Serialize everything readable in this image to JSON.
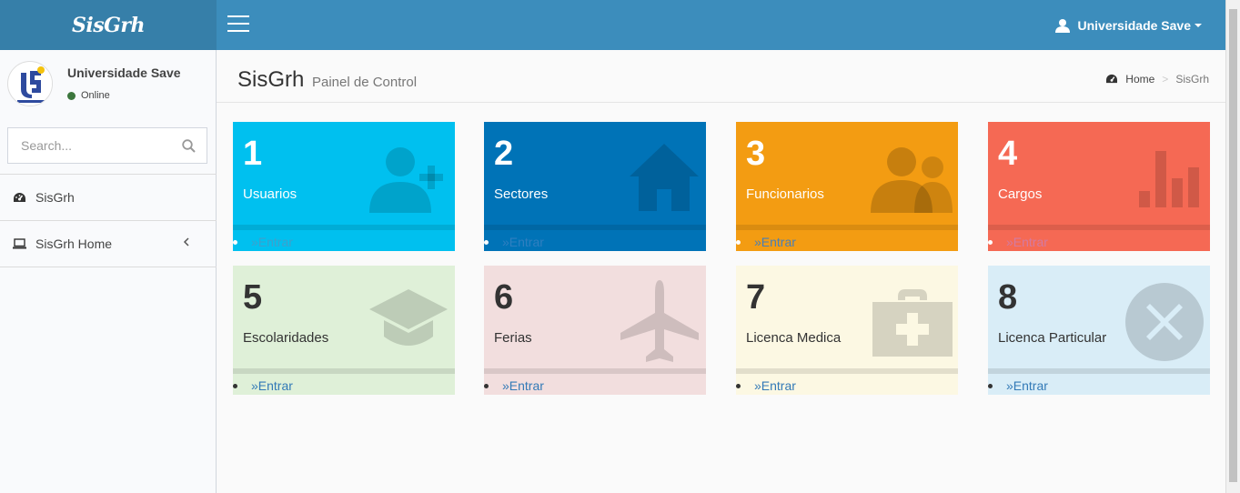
{
  "app": {
    "logo": "SisGrh"
  },
  "navbar": {
    "user": "Universidade Save"
  },
  "sidebar": {
    "user_name": "Universidade Save",
    "status": "Online",
    "search_placeholder": "Search...",
    "items": [
      {
        "label": "SisGrh"
      },
      {
        "label": "SisGrh Home"
      }
    ]
  },
  "header": {
    "title": "SisGrh",
    "subtitle": "Painel de Control",
    "breadcrumb": [
      "Home",
      "SisGrh"
    ]
  },
  "boxes": [
    {
      "number": "1",
      "label": "Usuarios",
      "link": "»Entrar",
      "icon": "add-user-icon",
      "color": "#00c0ef"
    },
    {
      "number": "2",
      "label": "Sectores",
      "link": "»Entrar",
      "icon": "home-icon",
      "color": "#0073b7"
    },
    {
      "number": "3",
      "label": "Funcionarios",
      "link": "»Entrar",
      "icon": "users-icon",
      "color": "#f39c12"
    },
    {
      "number": "4",
      "label": "Cargos",
      "link": "»Entrar",
      "icon": "bar-chart-icon",
      "color": "#f56954"
    },
    {
      "number": "5",
      "label": "Escolaridades",
      "link": "»Entrar",
      "icon": "graduation-cap-icon",
      "color": "#dff0d8"
    },
    {
      "number": "6",
      "label": "Ferias",
      "link": "»Entrar",
      "icon": "plane-icon",
      "color": "#f2dede"
    },
    {
      "number": "7",
      "label": "Licenca Medica",
      "link": "»Entrar",
      "icon": "medkit-icon",
      "color": "#fcf8e3"
    },
    {
      "number": "8",
      "label": "Licenca Particular",
      "link": "»Entrar",
      "icon": "times-circle-icon",
      "color": "#d9edf7"
    }
  ]
}
